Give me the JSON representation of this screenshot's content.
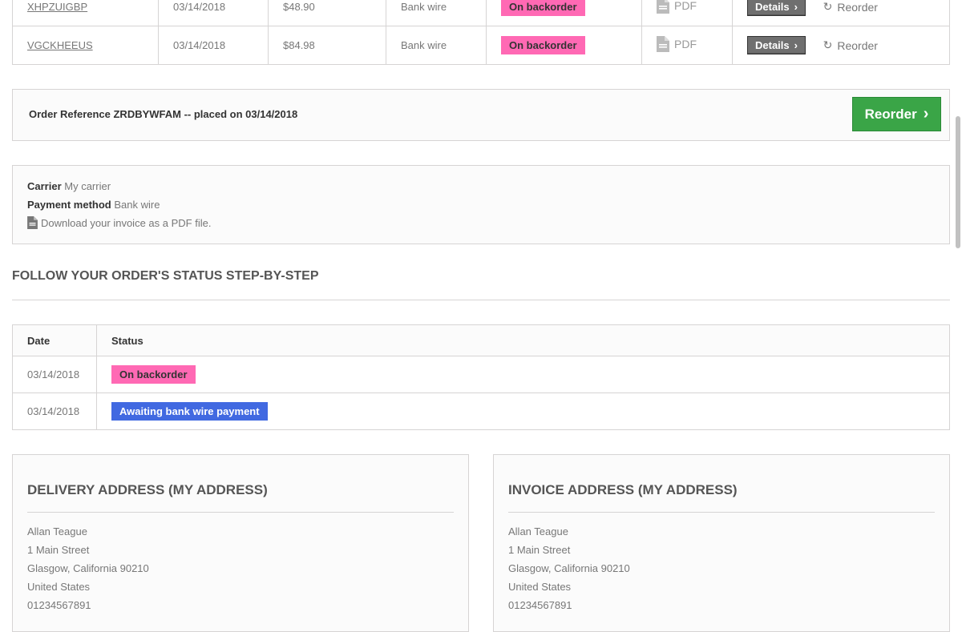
{
  "orders": [
    {
      "reference": "XHPZUIGBP",
      "date": "03/14/2018",
      "price": "$48.90",
      "payment": "Bank wire",
      "status": "On backorder",
      "invoice": "PDF",
      "details": "Details",
      "reorder": "Reorder"
    },
    {
      "reference": "VGCKHEEUS",
      "date": "03/14/2018",
      "price": "$84.98",
      "payment": "Bank wire",
      "status": "On backorder",
      "invoice": "PDF",
      "details": "Details",
      "reorder": "Reorder"
    }
  ],
  "order_ref": {
    "text": "Order Reference ZRDBYWFAM -- placed on 03/14/2018",
    "button": "Reorder"
  },
  "info": {
    "carrier_label": "Carrier",
    "carrier_value": "My carrier",
    "payment_label": "Payment method",
    "payment_value": "Bank wire",
    "download_text": "Download your invoice as a PDF file."
  },
  "follow_heading": "FOLLOW YOUR ORDER'S STATUS STEP-BY-STEP",
  "status_table": {
    "headers": [
      "Date",
      "Status"
    ],
    "rows": [
      {
        "date": "03/14/2018",
        "status": "On backorder",
        "color": "#ff69b4"
      },
      {
        "date": "03/14/2018",
        "status": "Awaiting bank wire payment",
        "color": "#4169e1"
      }
    ]
  },
  "delivery": {
    "title": "DELIVERY ADDRESS (MY ADDRESS)",
    "lines": [
      "Allan Teague",
      "1 Main Street",
      "Glasgow, California 90210",
      "United States",
      "01234567891"
    ]
  },
  "invoice": {
    "title": "INVOICE ADDRESS (MY ADDRESS)",
    "lines": [
      "Allan Teague",
      "1 Main Street",
      "Glasgow, California 90210",
      "United States",
      "01234567891"
    ]
  },
  "colors": {
    "badge_pink": "#ff69b4",
    "badge_blue": "#4169e1",
    "reorder_green": "#3aa547",
    "details_gray": "#6f6f6f"
  }
}
